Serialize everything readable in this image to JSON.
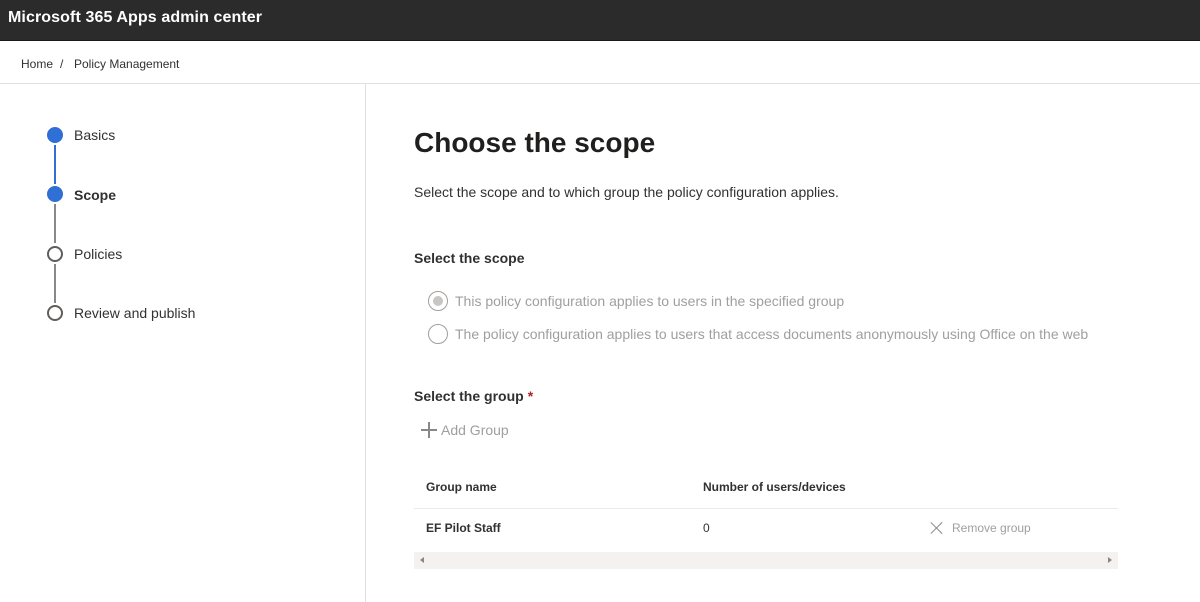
{
  "app": {
    "title": "Microsoft 365 Apps admin center"
  },
  "breadcrumb": {
    "home": "Home",
    "separator": "/",
    "current": "Policy Management"
  },
  "steps": [
    {
      "label": "Basics",
      "state": "completed"
    },
    {
      "label": "Scope",
      "state": "current"
    },
    {
      "label": "Policies",
      "state": "pending"
    },
    {
      "label": "Review and publish",
      "state": "pending"
    }
  ],
  "main": {
    "title": "Choose the scope",
    "description": "Select the scope and to which group the policy configuration applies.",
    "scope_label": "Select the scope",
    "scope_options": [
      {
        "label": "This policy configuration applies to users in the specified group",
        "checked": true,
        "disabled": true
      },
      {
        "label": "The policy configuration applies to users that access documents anonymously using Office on the web",
        "checked": false,
        "disabled": true
      }
    ],
    "group_label": "Select the group",
    "required_marker": "*",
    "add_group": "Add Group"
  },
  "table": {
    "columns": [
      "Group name",
      "Number of users/devices"
    ],
    "rows": [
      {
        "group_name": "EF Pilot Staff",
        "count": "0",
        "action": "Remove group"
      }
    ]
  },
  "colors": {
    "topbar": "#2b2b2b",
    "accent": "#2f6fd6",
    "disabled_text": "#a19f9d",
    "required": "#a4262c"
  },
  "icons": {
    "add": "plus-icon",
    "remove": "close-icon",
    "scroll_left": "chevron-left-icon",
    "scroll_right": "chevron-right-icon"
  }
}
